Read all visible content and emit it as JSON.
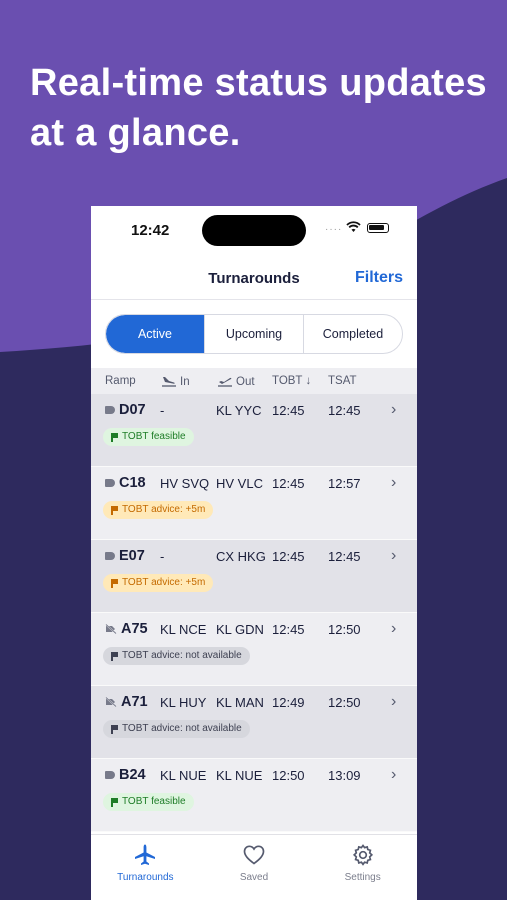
{
  "headline": "Real-time status updates at a glance.",
  "status_bar": {
    "time": "12:42",
    "dots": "····"
  },
  "nav": {
    "title": "Turnarounds",
    "filters": "Filters"
  },
  "segments": [
    {
      "label": "Active",
      "active": true
    },
    {
      "label": "Upcoming",
      "active": false
    },
    {
      "label": "Completed",
      "active": false
    }
  ],
  "columns": {
    "ramp": "Ramp",
    "in": "In",
    "out": "Out",
    "tobt": "TOBT ↓",
    "tsat": "TSAT"
  },
  "rows": [
    {
      "ramp": "D07",
      "in": "-",
      "out": "KL YYC",
      "tobt": "12:45",
      "tsat": "12:45",
      "badge": "TOBT feasible",
      "badge_type": "green",
      "icon": "tag-icon"
    },
    {
      "ramp": "C18",
      "in": "HV SVQ",
      "out": "HV VLC",
      "tobt": "12:45",
      "tsat": "12:57",
      "badge": "TOBT advice: +5m",
      "badge_type": "amber",
      "icon": "tag-icon"
    },
    {
      "ramp": "E07",
      "in": "-",
      "out": "CX HKG",
      "tobt": "12:45",
      "tsat": "12:45",
      "badge": "TOBT advice: +5m",
      "badge_type": "amber",
      "icon": "tag-icon"
    },
    {
      "ramp": "A75",
      "in": "KL NCE",
      "out": "KL GDN",
      "tobt": "12:45",
      "tsat": "12:50",
      "badge": "TOBT advice: not available",
      "badge_type": "gray",
      "icon": "tag-off-icon"
    },
    {
      "ramp": "A71",
      "in": "KL HUY",
      "out": "KL MAN",
      "tobt": "12:49",
      "tsat": "12:50",
      "badge": "TOBT advice: not available",
      "badge_type": "gray",
      "icon": "tag-off-icon"
    },
    {
      "ramp": "B24",
      "in": "KL NUE",
      "out": "KL NUE",
      "tobt": "12:50",
      "tsat": "13:09",
      "badge": "TOBT feasible",
      "badge_type": "green",
      "icon": "tag-icon"
    }
  ],
  "tabs": [
    {
      "label": "Turnarounds",
      "icon": "airplane-icon",
      "active": true
    },
    {
      "label": "Saved",
      "icon": "heart-icon",
      "active": false
    },
    {
      "label": "Settings",
      "icon": "gear-icon",
      "active": false
    }
  ],
  "colors": {
    "accent": "#2168d6",
    "purple": "#6a4fb0",
    "navy": "#2e2a5e"
  }
}
